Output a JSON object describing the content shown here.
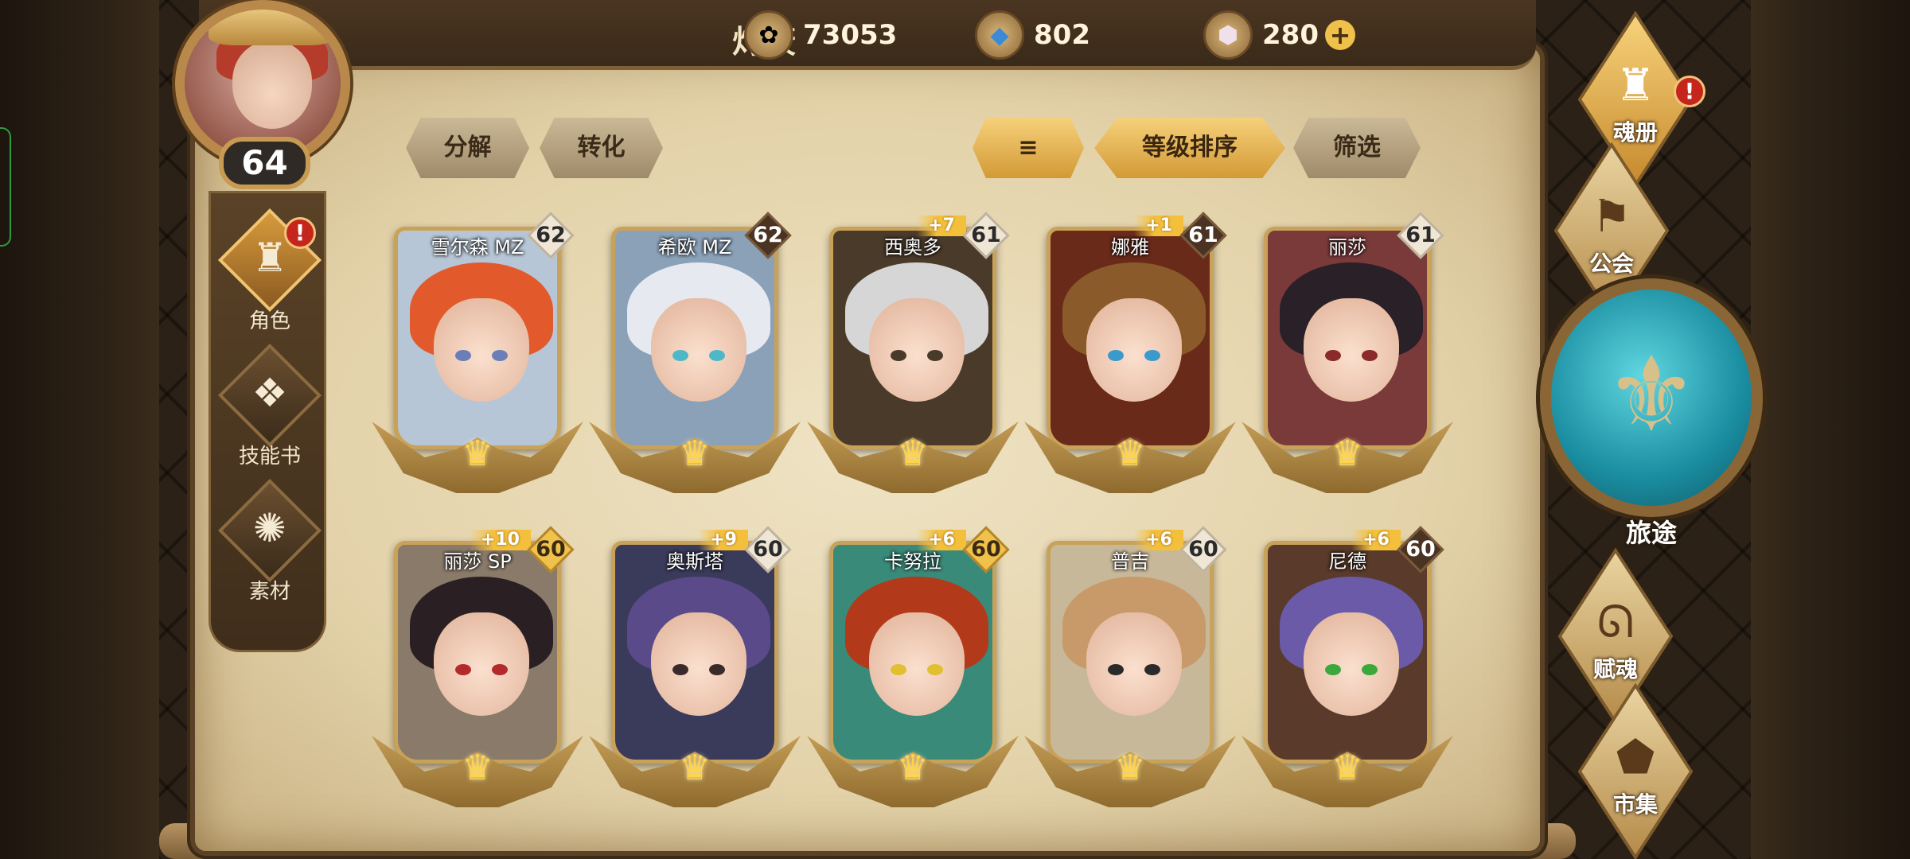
{
  "player": {
    "name": "灼筱",
    "level": "64"
  },
  "resources": {
    "gold": {
      "icon": "gold-coin-icon",
      "value": "73053"
    },
    "crystal": {
      "icon": "blue-crystal-icon",
      "value": "802"
    },
    "gem": {
      "icon": "gem-icon",
      "value": "280",
      "plus": "+"
    }
  },
  "left_nav": [
    {
      "label": "角色",
      "icon": "helmet-icon",
      "glyph": "♜",
      "alert": "!"
    },
    {
      "label": "技能书",
      "icon": "skill-book-icon",
      "glyph": "❖"
    },
    {
      "label": "素材",
      "icon": "material-icon",
      "glyph": "✺"
    }
  ],
  "toolbar": {
    "decompose": "分解",
    "convert": "转化",
    "sort_icon": "≡",
    "sort_level": "等级排序",
    "filter": "筛选"
  },
  "heroes": [
    {
      "name": "雪尔森 MZ",
      "level": "62",
      "level_style": "light",
      "plus": "",
      "hair": "#e25a2c",
      "bg": "#b7c6d6",
      "eye": "#6a7fb8"
    },
    {
      "name": "希欧 MZ",
      "level": "62",
      "level_style": "dark",
      "plus": "",
      "hair": "#e6e9ef",
      "bg": "#8aa1b8",
      "eye": "#4fb8c6"
    },
    {
      "name": "西奥多",
      "level": "61",
      "level_style": "light",
      "plus": "+7",
      "hair": "#d6d6d6",
      "bg": "#4a3a2a",
      "eye": "#4a3a2a"
    },
    {
      "name": "娜雅",
      "level": "61",
      "level_style": "dark",
      "plus": "+1",
      "hair": "#8a5a2a",
      "bg": "#6a2a1a",
      "eye": "#3a9acb"
    },
    {
      "name": "丽莎",
      "level": "61",
      "level_style": "light",
      "plus": "",
      "hair": "#2a2028",
      "bg": "#7a3a3a",
      "eye": "#8a2a2a"
    },
    {
      "name": "丽莎 SP",
      "level": "60",
      "level_style": "gold",
      "plus": "+10",
      "hair": "#2a2024",
      "bg": "#8a7a6a",
      "eye": "#b22a2a"
    },
    {
      "name": "奥斯塔",
      "level": "60",
      "level_style": "light",
      "plus": "+9",
      "hair": "#5a4a8a",
      "bg": "#3a3a5a",
      "eye": "#3a2a2a"
    },
    {
      "name": "卡努拉",
      "level": "60",
      "level_style": "gold",
      "plus": "+6",
      "hair": "#b23a1a",
      "bg": "#3a8a7a",
      "eye": "#e0c030"
    },
    {
      "name": "普吉",
      "level": "60",
      "level_style": "light",
      "plus": "+6",
      "hair": "#c89a6a",
      "bg": "#c8b89a",
      "eye": "#2a2a2a"
    },
    {
      "name": "尼德",
      "level": "60",
      "level_style": "dark",
      "plus": "+6",
      "hair": "#6a5aa8",
      "bg": "#5a3a2a",
      "eye": "#3aa83a"
    }
  ],
  "right_nav": {
    "soul_book": {
      "label": "魂册",
      "icon": "soul-helmet-icon",
      "glyph": "♜",
      "alert": "!"
    },
    "guild": {
      "label": "公会",
      "icon": "guild-banner-icon",
      "glyph": "⚑"
    },
    "journey": {
      "label": "旅途",
      "icon": "journey-emblem-icon",
      "glyph": "⚜"
    },
    "soul_infuse": {
      "label": "赋魂",
      "icon": "flame-icon",
      "glyph": "ᘏ"
    },
    "market": {
      "label": "市集",
      "icon": "gem-market-icon",
      "glyph": "⬟"
    }
  },
  "colors": {
    "accent_gold": "#f0c24c",
    "alert_red": "#c4261c",
    "journey_teal": "#1a8da0"
  }
}
